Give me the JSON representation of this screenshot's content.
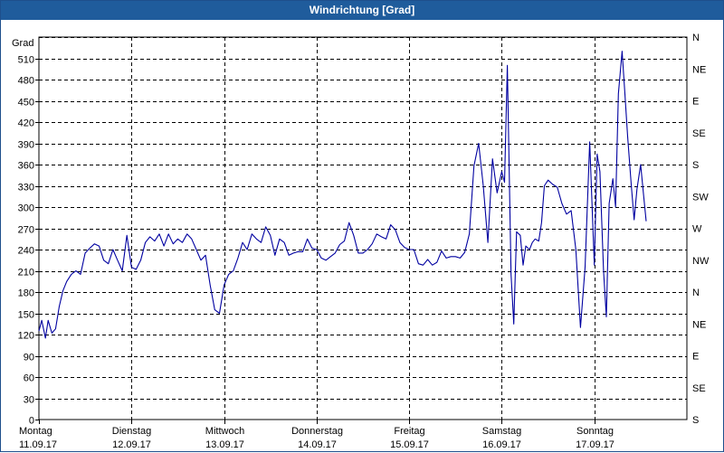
{
  "window": {
    "title": "Windrichtung [Grad]"
  },
  "chart_data": {
    "type": "line",
    "title": "Windrichtung [Grad]",
    "ylabel": "Grad",
    "ylim": [
      0,
      540
    ],
    "yticks": [
      0,
      30,
      60,
      90,
      120,
      150,
      180,
      210,
      240,
      270,
      300,
      330,
      360,
      390,
      420,
      450,
      480,
      510
    ],
    "right_axis_labels": [
      "S",
      "SE",
      "E",
      "NE",
      "N",
      "NW",
      "W",
      "SW",
      "S",
      "SE",
      "E",
      "NE",
      "N"
    ],
    "x_ticks": [
      {
        "day": "Montag",
        "date": "11.09.17"
      },
      {
        "day": "Dienstag",
        "date": "12.09.17"
      },
      {
        "day": "Mittwoch",
        "date": "13.09.17"
      },
      {
        "day": "Donnerstag",
        "date": "14.09.17"
      },
      {
        "day": "Freitag",
        "date": "15.09.17"
      },
      {
        "day": "Samstag",
        "date": "16.09.17"
      },
      {
        "day": "Sonntag",
        "date": "17.09.17"
      }
    ],
    "grid": true,
    "series_color": "#0000a0",
    "series": [
      {
        "x_days": [
          0.0,
          0.03,
          0.07,
          0.1,
          0.14,
          0.18,
          0.22,
          0.26,
          0.3,
          0.35,
          0.4,
          0.45,
          0.5,
          0.55,
          0.6,
          0.65,
          0.7,
          0.75,
          0.8,
          0.85,
          0.9,
          0.95,
          1.0,
          1.05,
          1.1,
          1.15,
          1.2,
          1.25,
          1.3,
          1.35,
          1.4,
          1.45,
          1.5,
          1.55,
          1.6,
          1.65,
          1.7,
          1.75,
          1.8,
          1.85,
          1.9,
          1.95,
          2.0,
          2.05,
          2.1,
          2.15,
          2.2,
          2.25,
          2.3,
          2.35,
          2.4,
          2.45,
          2.5,
          2.55,
          2.6,
          2.65,
          2.7,
          2.75,
          2.8,
          2.85,
          2.9,
          2.95,
          3.0,
          3.05,
          3.1,
          3.15,
          3.2,
          3.25,
          3.3,
          3.35,
          3.4,
          3.45,
          3.5,
          3.55,
          3.6,
          3.65,
          3.7,
          3.75,
          3.8,
          3.85,
          3.9,
          3.95,
          4.0,
          4.05,
          4.1,
          4.15,
          4.2,
          4.25,
          4.3,
          4.35,
          4.4,
          4.45,
          4.5,
          4.55,
          4.6,
          4.65,
          4.7,
          4.75,
          4.8,
          4.85,
          4.9,
          4.95,
          5.0,
          5.03,
          5.06,
          5.1,
          5.13,
          5.16,
          5.2,
          5.23,
          5.26,
          5.3,
          5.33,
          5.36,
          5.4,
          5.43,
          5.46,
          5.5,
          5.55,
          5.6,
          5.65,
          5.7,
          5.75,
          5.8,
          5.85,
          5.9,
          5.95,
          6.0,
          6.03,
          6.06,
          6.1,
          6.13,
          6.16,
          6.2,
          6.23,
          6.26,
          6.3,
          6.33,
          6.36,
          6.4,
          6.43,
          6.46,
          6.5,
          6.53,
          6.56,
          6.6,
          6.63,
          6.66,
          6.7,
          6.73,
          6.76,
          6.8,
          6.83,
          6.86,
          6.9,
          6.93,
          6.97
        ],
        "values": [
          125,
          140,
          115,
          140,
          122,
          128,
          160,
          182,
          195,
          205,
          210,
          205,
          235,
          242,
          248,
          245,
          225,
          220,
          240,
          225,
          210,
          260,
          215,
          212,
          225,
          250,
          258,
          252,
          262,
          245,
          262,
          248,
          255,
          250,
          262,
          255,
          240,
          225,
          232,
          190,
          155,
          150,
          190,
          205,
          210,
          228,
          250,
          240,
          262,
          255,
          250,
          272,
          260,
          232,
          255,
          250,
          232,
          235,
          237,
          237,
          255,
          242,
          240,
          228,
          225,
          230,
          235,
          247,
          252,
          278,
          260,
          235,
          235,
          240,
          248,
          262,
          258,
          255,
          275,
          268,
          250,
          243,
          240,
          240,
          220,
          218,
          226,
          218,
          222,
          238,
          228,
          230,
          230,
          228,
          236,
          262,
          358,
          390,
          330,
          250,
          368,
          320,
          350,
          335,
          500,
          205,
          135,
          265,
          260,
          218,
          245,
          240,
          250,
          255,
          252,
          278,
          330,
          338,
          332,
          328,
          305,
          290,
          295,
          240,
          130,
          215,
          392,
          218,
          375,
          350,
          210,
          145,
          305,
          340,
          300,
          460,
          520,
          460,
          400,
          330,
          282,
          325,
          360,
          320,
          280
        ]
      }
    ]
  }
}
